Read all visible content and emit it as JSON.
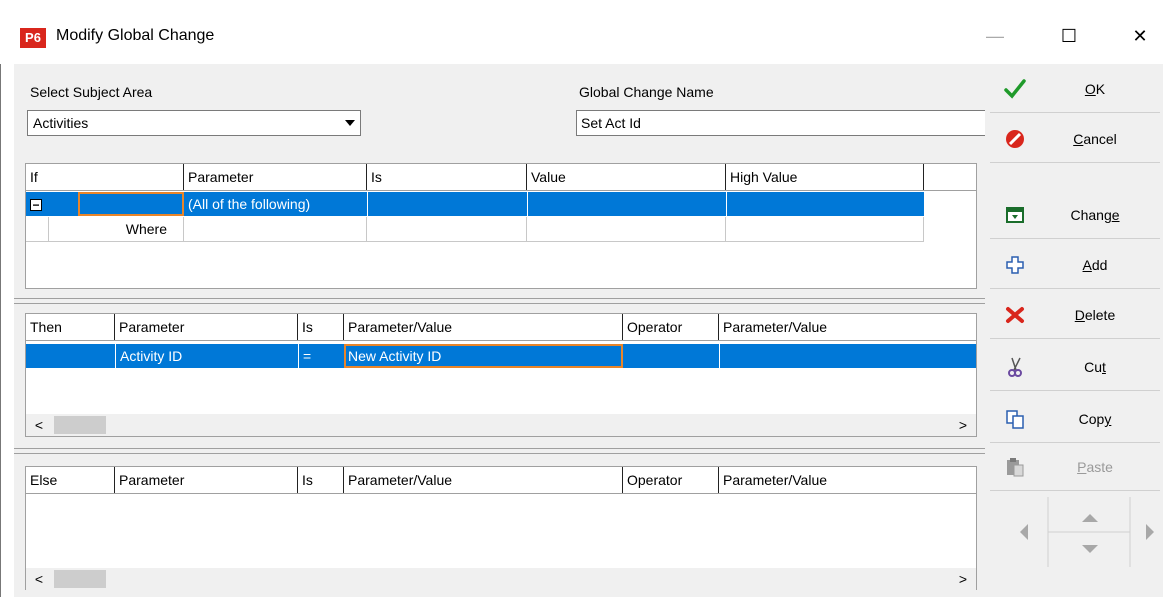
{
  "window": {
    "app_badge": "P6",
    "title": "Modify Global Change",
    "minimize": "—",
    "maximize": "☐",
    "close": "✕"
  },
  "form": {
    "subject_area_label": "Select Subject Area",
    "subject_area_value": "Activities",
    "name_label": "Global Change Name",
    "name_value": "Set Act Id"
  },
  "if_grid": {
    "headers": [
      "If",
      "Parameter",
      "Is",
      "Value",
      "High Value"
    ],
    "rows": [
      {
        "toggle": "−",
        "if": "",
        "parameter": "(All of the following)",
        "is": "",
        "value": "",
        "high_value": ""
      },
      {
        "if": "Where",
        "parameter": "",
        "is": "",
        "value": "",
        "high_value": ""
      }
    ]
  },
  "then_grid": {
    "headers": [
      "Then",
      "Parameter",
      "Is",
      "Parameter/Value",
      "Operator",
      "Parameter/Value"
    ],
    "rows": [
      {
        "then": "",
        "parameter": "Activity ID",
        "is": "=",
        "param_value": "New Activity ID",
        "operator": "",
        "param_value2": ""
      }
    ],
    "scroll_left": "<",
    "scroll_right": ">"
  },
  "else_grid": {
    "headers": [
      "Else",
      "Parameter",
      "Is",
      "Parameter/Value",
      "Operator",
      "Parameter/Value"
    ],
    "scroll_left": "<",
    "scroll_right": ">"
  },
  "sidebar": {
    "ok": {
      "pre": "",
      "u": "O",
      "post": "K"
    },
    "cancel": {
      "pre": "",
      "u": "C",
      "post": "ancel"
    },
    "change": {
      "pre": "Chang",
      "u": "e",
      "post": ""
    },
    "add": {
      "pre": "",
      "u": "A",
      "post": "dd"
    },
    "delete": {
      "pre": "",
      "u": "D",
      "post": "elete"
    },
    "cut": {
      "pre": "Cu",
      "u": "t",
      "post": ""
    },
    "copy": {
      "pre": "Cop",
      "u": "y",
      "post": ""
    },
    "paste": {
      "pre": "",
      "u": "P",
      "post": "aste"
    }
  },
  "colors": {
    "selection": "#0078d7",
    "focus_border": "#e8852a",
    "ok_check": "#1f9a2a",
    "cancel_red": "#d9261c"
  }
}
